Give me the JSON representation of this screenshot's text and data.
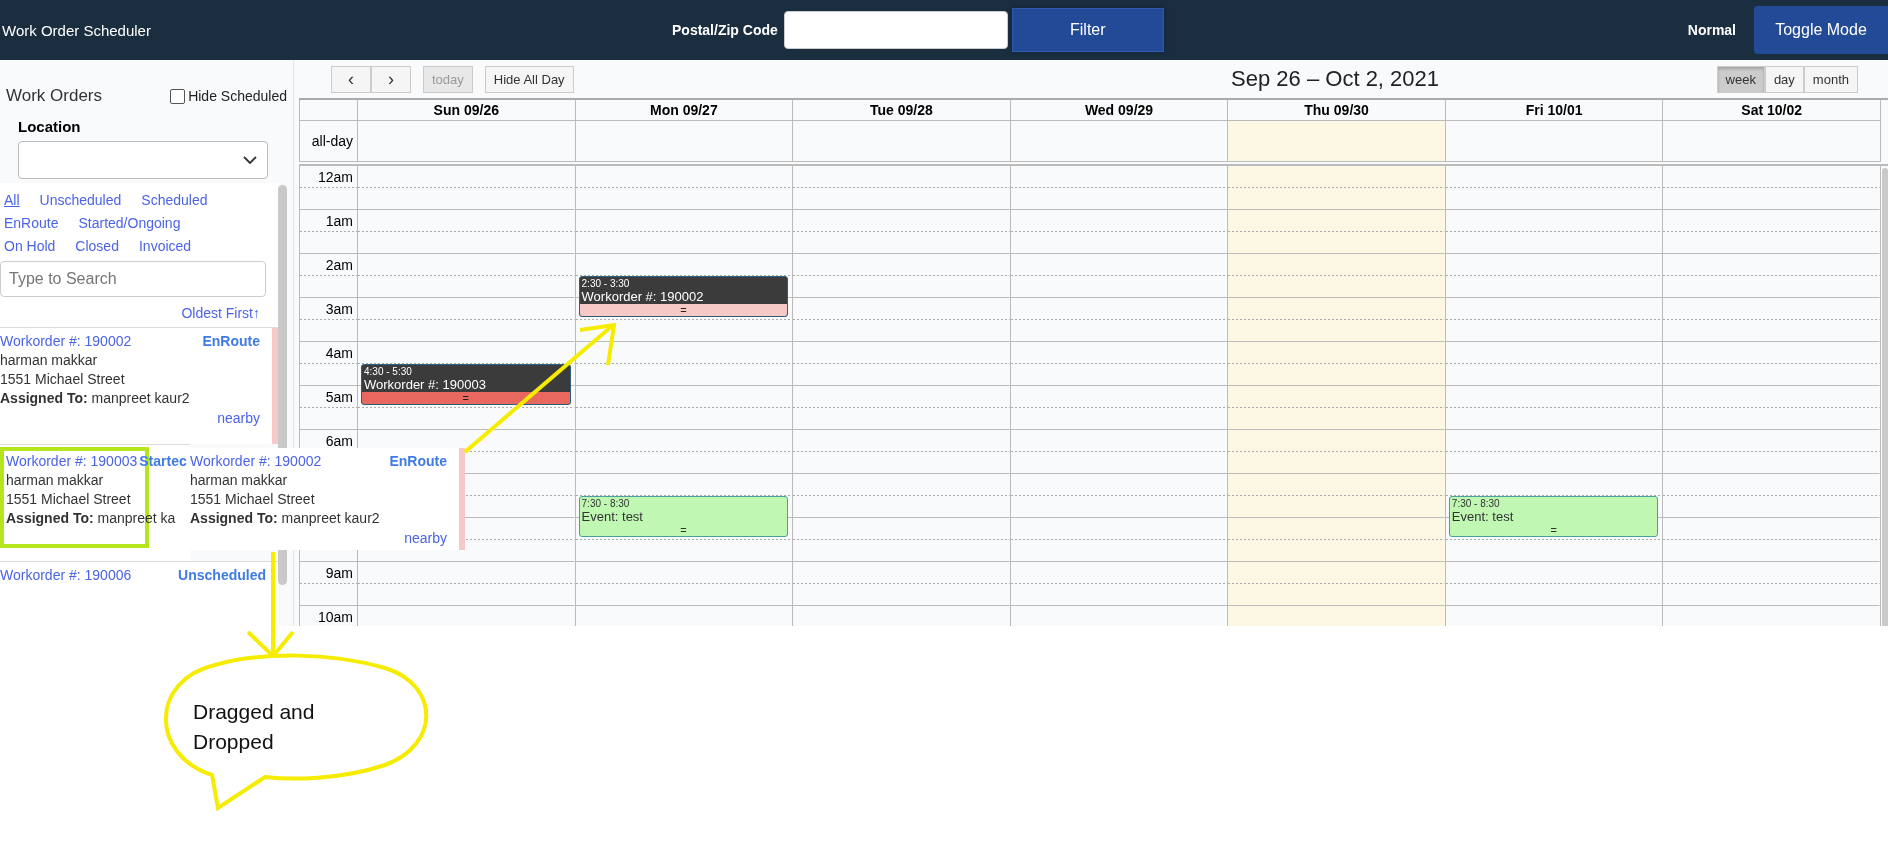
{
  "top_bar": {
    "title": "Work Order Scheduler",
    "postal_label": "Postal/Zip Code",
    "filter_button": "Filter",
    "mode_label": "Normal",
    "toggle_button": "Toggle Mode"
  },
  "sidebar": {
    "heading": "Work Orders",
    "hide_scheduled": {
      "label": "Hide Scheduled",
      "checked": false
    },
    "location_label": "Location",
    "filters": [
      {
        "label": "All",
        "selected": true
      },
      {
        "label": "Unscheduled",
        "selected": false
      },
      {
        "label": "Scheduled",
        "selected": false
      },
      {
        "label": "EnRoute",
        "selected": false
      },
      {
        "label": "Started/Ongoing",
        "selected": false
      },
      {
        "label": "On Hold",
        "selected": false
      },
      {
        "label": "Closed",
        "selected": false
      },
      {
        "label": "Invoiced",
        "selected": false
      }
    ],
    "search_placeholder": "Type to Search",
    "sort": "Oldest First",
    "sort_icon": "↑",
    "cards": [
      {
        "number": "Workorder #: 190002",
        "status": "EnRoute",
        "customer": "harman makkar",
        "address": "1551 Michael Street",
        "assigned_label": "Assigned To:",
        "assigned": "manpreet kaur2",
        "nearby": "nearby",
        "color": "#f6c9c6",
        "covered": false
      },
      {
        "number": "Workorder #: 190003",
        "status": "Startec",
        "customer": "harman makkar",
        "address": "1551 Michael Street",
        "assigned_label": "Assigned To:",
        "assigned": "manpreet ka",
        "covered": true
      },
      {
        "number": "Workorder #: 190006",
        "status": "Unscheduled",
        "covered": false
      }
    ]
  },
  "calendar": {
    "toolbar": {
      "prev": "‹",
      "next": "›",
      "today": "today",
      "hide_all_day": "Hide All Day",
      "title": "Sep 26 – Oct 2, 2021",
      "views": [
        {
          "label": "week",
          "selected": true
        },
        {
          "label": "day",
          "selected": false
        },
        {
          "label": "month",
          "selected": false
        }
      ]
    },
    "all_day_label": "all-day",
    "hours": [
      "12am",
      "1am",
      "2am",
      "3am",
      "4am",
      "5am",
      "6am",
      "9am",
      "10am"
    ],
    "days": [
      {
        "label": "Sun 09/26",
        "today": false,
        "events": [
          {
            "kind": "workorder",
            "time": "4:30 - 5:30",
            "title": "Workorder #: 190003",
            "color": "#e8685f",
            "handle": "="
          }
        ]
      },
      {
        "label": "Mon 09/27",
        "today": false,
        "events": [
          {
            "kind": "workorder",
            "time": "2:30 - 3:30",
            "title": "Workorder #: 190002",
            "color": "#f6c9c6",
            "handle": "="
          },
          {
            "kind": "event",
            "time": "7:30 - 8:30",
            "title": "Event: test",
            "handle": "="
          }
        ]
      },
      {
        "label": "Tue 09/28",
        "today": false
      },
      {
        "label": "Wed 09/29",
        "today": false
      },
      {
        "label": "Thu 09/30",
        "today": true
      },
      {
        "label": "Fri 10/01",
        "today": false,
        "events": [
          {
            "kind": "event",
            "time": "7:30 - 8:30",
            "title": "Event: test",
            "handle": "="
          }
        ]
      },
      {
        "label": "Sat 10/02",
        "today": false
      }
    ]
  },
  "dragged_card": {
    "number": "Workorder #: 190002",
    "status": "EnRoute",
    "customer": "harman makkar",
    "address": "1551 Michael Street",
    "assigned_label": "Assigned To:",
    "assigned": "manpreet kaur2",
    "nearby": "nearby",
    "color": "#f6c9c6"
  },
  "annotation": {
    "callout": "Dragged and Dropped"
  }
}
